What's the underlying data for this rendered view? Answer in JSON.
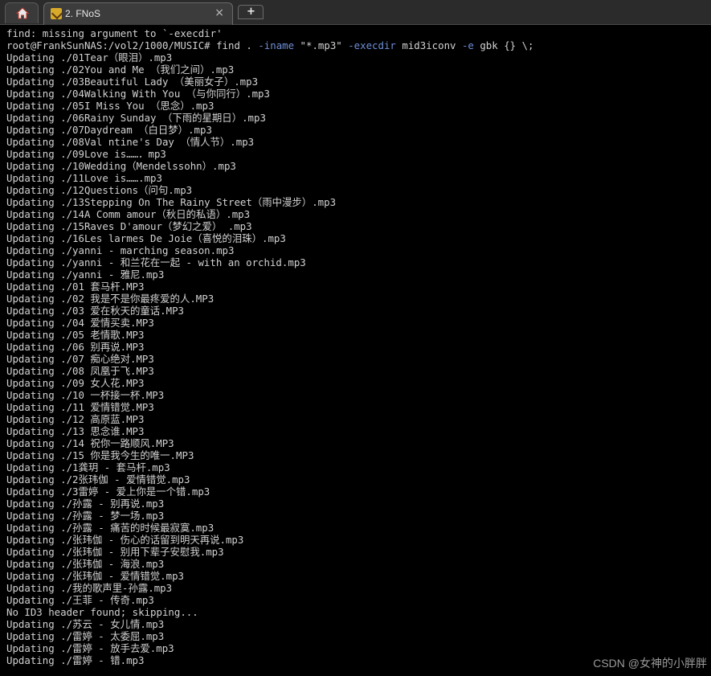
{
  "tabs": {
    "home_icon": "home-icon",
    "active_tab": {
      "title": "2. FNoS",
      "icon": "wrench-icon",
      "close": "×"
    },
    "new_tab_icon": "+"
  },
  "terminal": {
    "lines": [
      "find: missing argument to `-execdir'",
      "root@FrankSunNAS:/vol2/1000/MUSIC# find . -iname \"*.mp3\" -execdir mid3iconv -e gbk {} \\;",
      "Updating ./01Tear（眼泪）.mp3",
      "Updating ./02You and Me （我们之间）.mp3",
      "Updating ./03Beautiful Lady （美丽女子）.mp3",
      "Updating ./04Walking With You （与你同行）.mp3",
      "Updating ./05I Miss You （思念）.mp3",
      "Updating ./06Rainy Sunday （下雨的星期日）.mp3",
      "Updating ./07Daydream （白日梦）.mp3",
      "Updating ./08Val ntine's Day （情人节）.mp3",
      "Updating ./09Love is……．mp3",
      "Updating ./10Wedding（Mendelssohn）.mp3",
      "Updating ./11Love is…….mp3",
      "Updating ./12Questions（问句.mp3",
      "Updating ./13Stepping On The Rainy Street（雨中漫步）.mp3",
      "Updating ./14A Comm amour（秋日的私语）.mp3",
      "Updating ./15Raves D'amour（梦幻之爱） .mp3",
      "Updating ./16Les larmes De Joie（喜悦的泪珠）.mp3",
      "Updating ./yanni - marching season.mp3",
      "Updating ./yanni - 和兰花在一起 - with an orchid.mp3",
      "Updating ./yanni - 雅尼.mp3",
      "Updating ./01 套马杆.MP3",
      "Updating ./02 我是不是你最疼爱的人.MP3",
      "Updating ./03 爱在秋天的童话.MP3",
      "Updating ./04 爱情买卖.MP3",
      "Updating ./05 老情歌.MP3",
      "Updating ./06 别再说.MP3",
      "Updating ./07 痴心绝对.MP3",
      "Updating ./08 凤凰于飞.MP3",
      "Updating ./09 女人花.MP3",
      "Updating ./10 一杯接一杯.MP3",
      "Updating ./11 爱情错觉.MP3",
      "Updating ./12 高原蓝.MP3",
      "Updating ./13 思念谁.MP3",
      "Updating ./14 祝你一路顺风.MP3",
      "Updating ./15 你是我今生的唯一.MP3",
      "Updating ./1龚玥 - 套马杆.mp3",
      "Updating ./2张玮伽 - 爱情错觉.mp3",
      "Updating ./3雷婷 - 爱上你是一个错.mp3",
      "Updating ./孙露 - 别再说.mp3",
      "Updating ./孙露 - 梦一场.mp3",
      "Updating ./孙露 - 痛苦的时候最寂寞.mp3",
      "Updating ./张玮伽 - 伤心的话留到明天再说.mp3",
      "Updating ./张玮伽 - 别用下辈子安慰我.mp3",
      "Updating ./张玮伽 - 海浪.mp3",
      "Updating ./张玮伽 - 爱情错觉.mp3",
      "Updating ./我的歌声里-孙露.mp3",
      "Updating ./王菲 - 传奇.mp3",
      "No ID3 header found; skipping...",
      "Updating ./苏云 - 女儿情.mp3",
      "Updating ./雷婷 - 太委屈.mp3",
      "Updating ./雷婷 - 放手去爱.mp3",
      "Updating ./雷婷 - 错.mp3"
    ],
    "command_parts": {
      "prompt": "root@FrankSunNAS:/vol2/1000/MUSIC# find . ",
      "opt1": "-iname",
      "mid1": " \"*.mp3\" ",
      "opt2": "-execdir",
      "mid2": " mid3iconv ",
      "opt3": "-e",
      "tail": " gbk {} \\;"
    }
  },
  "watermark": "CSDN @女神的小胖胖",
  "colors": {
    "background": "#000000",
    "text": "#d2d2d2",
    "option_highlight": "#6f8fd8"
  }
}
